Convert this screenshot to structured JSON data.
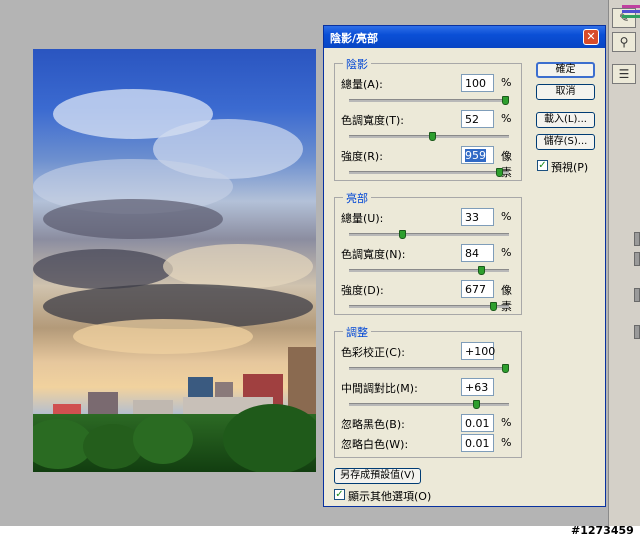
{
  "dialog": {
    "title": "陰影/亮部",
    "close_glyph": "✕",
    "shadows": {
      "group_label": "陰影",
      "amount": {
        "label": "總量(A):",
        "value": "100",
        "unit": "%",
        "slider_pct": 100
      },
      "tonal_width": {
        "label": "色調寬度(T):",
        "value": "52",
        "unit": "%",
        "slider_pct": 52
      },
      "radius": {
        "label": "強度(R):",
        "value": "959",
        "unit": "像素",
        "slider_pct": 96
      }
    },
    "highlights": {
      "group_label": "亮部",
      "amount": {
        "label": "總量(U):",
        "value": "33",
        "unit": "%",
        "slider_pct": 33
      },
      "tonal_width": {
        "label": "色調寬度(N):",
        "value": "84",
        "unit": "%",
        "slider_pct": 84
      },
      "radius": {
        "label": "強度(D):",
        "value": "677",
        "unit": "像素",
        "slider_pct": 92
      }
    },
    "adjustments": {
      "group_label": "調整",
      "color_correction": {
        "label": "色彩校正(C):",
        "value": "+100",
        "slider_pct": 100
      },
      "midtone_contrast": {
        "label": "中間調對比(M):",
        "value": "+63",
        "slider_pct": 81
      },
      "black_clip": {
        "label": "忽略黑色(B):",
        "value": "0.01",
        "unit": "%"
      },
      "white_clip": {
        "label": "忽略白色(W):",
        "value": "0.01",
        "unit": "%"
      }
    },
    "buttons": {
      "ok": "確定",
      "cancel": "取消",
      "load": "載入(L)...",
      "save": "儲存(S)...",
      "save_defaults": "另存成預設值(V)"
    },
    "preview": {
      "label": "預視(P)",
      "checked": true
    },
    "show_more": {
      "label": "顯示其他選項(O)",
      "checked": true
    }
  },
  "watermark": "#1273459",
  "right_panel": {
    "icons": [
      "brush-tool-icon",
      "stamp-tool-icon",
      "history-icon"
    ]
  }
}
